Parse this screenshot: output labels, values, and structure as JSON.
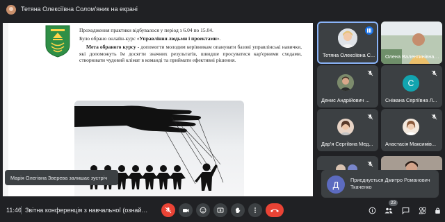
{
  "presenting": {
    "title": "Тетяна Олексіївна Солом'яник на екрані"
  },
  "slide": {
    "line1": "Проходження практики відбувалося у період з 6.04 по 15.04.",
    "line2_prefix": "Було обрано онлайн-курс «",
    "line2_bold": "Управління людьми і проектами",
    "line2_suffix": "».",
    "line3_bold": "Мета обраного курсу",
    "line3_rest": " - допомогти молодим керівникам опанувати базові управлінські навички, які допоможуть їм досягти значних результатів, швидше просуватися кар'єрними сходами, створювати чудовий клімат в команді та приймати ефективні рішення."
  },
  "toast_leave": {
    "text": "Марія Олегівна Зверева залишає зустріч"
  },
  "tiles": [
    {
      "name": "Тетяна Олексіївна С...",
      "active": true,
      "speaking": true
    },
    {
      "name": "Олена Валентинівна ..."
    },
    {
      "name": "Денис Андрійович ..."
    },
    {
      "name": "Сніжана Сергіївна Л...",
      "letter": "С"
    },
    {
      "name": "Дар'я Сергіївна Мед..."
    },
    {
      "name": "Анастасія Максимів..."
    },
    {
      "name": ""
    },
    {
      "name": ""
    }
  ],
  "toast_join": {
    "letter": "Д",
    "text": "Приєднується Дмитро Романович Ткаченко"
  },
  "bottom": {
    "time": "11:46",
    "meeting_name": "Звітна конференція з навчальної (ознайомчо...",
    "participants_count": "23"
  },
  "colors": {
    "background": "#202124",
    "tile": "#3c4043",
    "accent_blue": "#8ab4f8",
    "hangup_red": "#ea4335",
    "letter_avatar_teal": "#12a4af",
    "letter_avatar_indigo": "#5c6bc0"
  },
  "icons": {
    "mic_off": "mic-off-icon",
    "camera": "camera-icon",
    "emoji": "emoji-icon",
    "present": "present-screen-icon",
    "hand": "raise-hand-icon",
    "more": "more-options-icon",
    "hangup": "hang-up-icon",
    "info": "info-icon",
    "people": "people-icon",
    "chat": "chat-icon",
    "shapes": "activities-icon",
    "lock": "host-controls-icon"
  }
}
